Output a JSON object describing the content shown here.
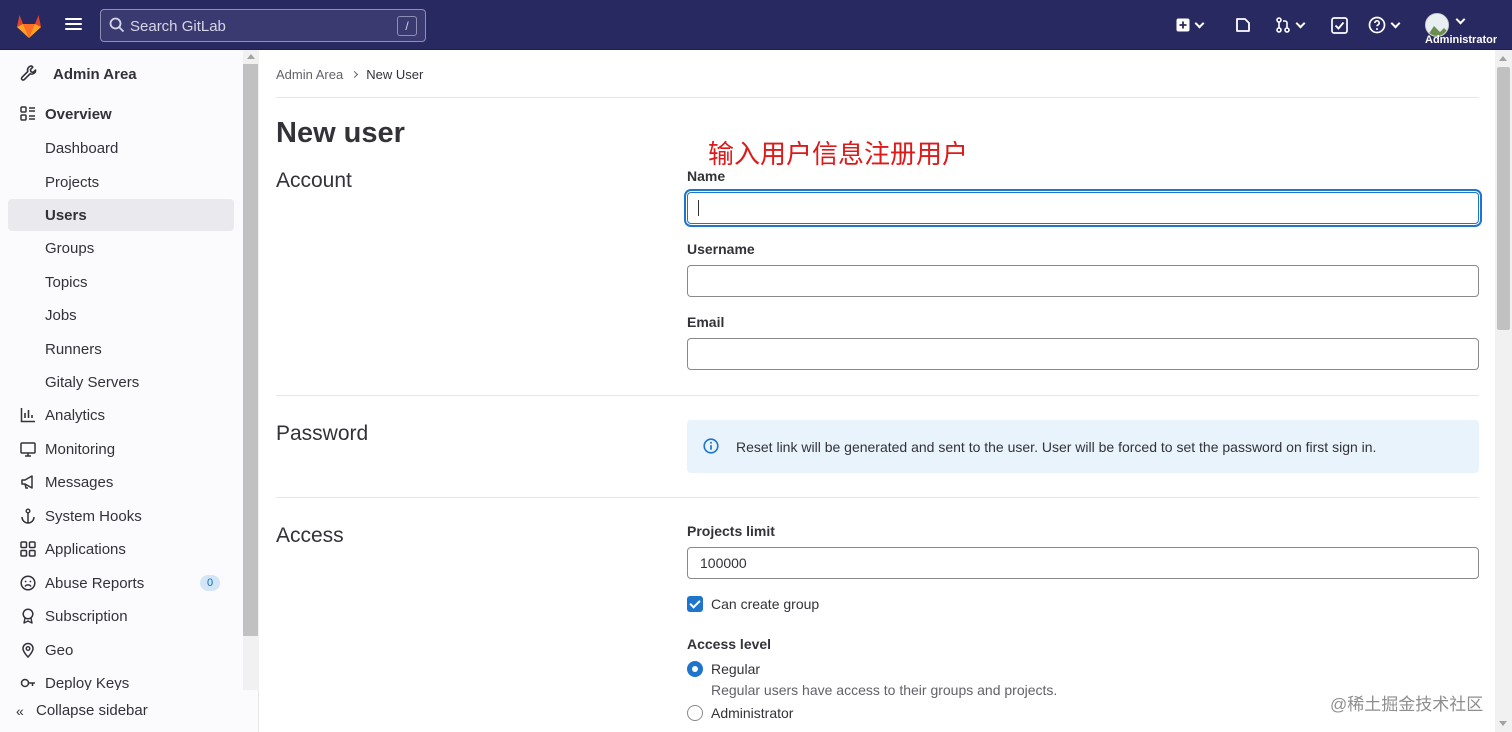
{
  "topbar": {
    "search_placeholder": "Search GitLab",
    "search_shortcut": "/",
    "user_name": "Administrator"
  },
  "sidebar": {
    "header": "Admin Area",
    "items": [
      {
        "label": "Overview",
        "icon": "overview-icon",
        "bold": true
      },
      {
        "label": "Dashboard"
      },
      {
        "label": "Projects"
      },
      {
        "label": "Users",
        "active": true
      },
      {
        "label": "Groups"
      },
      {
        "label": "Topics"
      },
      {
        "label": "Jobs"
      },
      {
        "label": "Runners"
      },
      {
        "label": "Gitaly Servers"
      },
      {
        "label": "Analytics",
        "icon": "analytics-icon"
      },
      {
        "label": "Monitoring",
        "icon": "monitoring-icon"
      },
      {
        "label": "Messages",
        "icon": "messages-icon"
      },
      {
        "label": "System Hooks",
        "icon": "anchor-icon"
      },
      {
        "label": "Applications",
        "icon": "applications-icon"
      },
      {
        "label": "Abuse Reports",
        "icon": "abuse-icon",
        "badge": "0"
      },
      {
        "label": "Subscription",
        "icon": "subscription-icon"
      },
      {
        "label": "Geo",
        "icon": "geo-icon"
      },
      {
        "label": "Deploy Keys",
        "icon": "key-icon"
      }
    ],
    "collapse_label": "Collapse sidebar"
  },
  "breadcrumb": {
    "parent": "Admin Area",
    "current": "New User"
  },
  "page": {
    "title": "New user",
    "annotation": "输入用户信息注册用户"
  },
  "account": {
    "section_title": "Account",
    "name_label": "Name",
    "name_value": "",
    "username_label": "Username",
    "username_value": "",
    "email_label": "Email",
    "email_value": ""
  },
  "password": {
    "section_title": "Password",
    "alert_text": "Reset link will be generated and sent to the user. User will be forced to set the password on first sign in."
  },
  "access": {
    "section_title": "Access",
    "projects_limit_label": "Projects limit",
    "projects_limit_value": "100000",
    "can_create_group_label": "Can create group",
    "can_create_group_checked": true,
    "access_level_label": "Access level",
    "regular_label": "Regular",
    "regular_help": "Regular users have access to their groups and projects.",
    "administrator_label": "Administrator"
  },
  "watermark": "@稀土掘金技术社区"
}
